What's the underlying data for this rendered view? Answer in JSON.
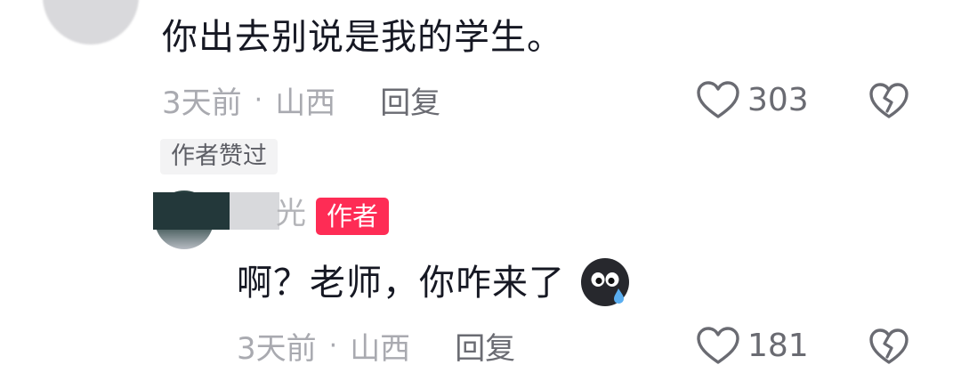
{
  "top_comment": {
    "text": "你出去别说是我的学生。",
    "time": "3天前",
    "dot": "·",
    "location": "山西",
    "reply_label": "回复",
    "like_count": "303",
    "author_liked_tag": "作者赞过"
  },
  "reply_comment": {
    "name_visible": "光",
    "author_badge": "作者",
    "text": "啊？老师，你咋来了",
    "emoji": "sweat-face-emoji",
    "time": "3天前",
    "dot": "·",
    "location": "山西",
    "reply_label": "回复",
    "like_count": "181"
  },
  "colors": {
    "author_badge": "#fe2c55",
    "meta_text": "#a9aab0",
    "main_text": "#161823"
  }
}
